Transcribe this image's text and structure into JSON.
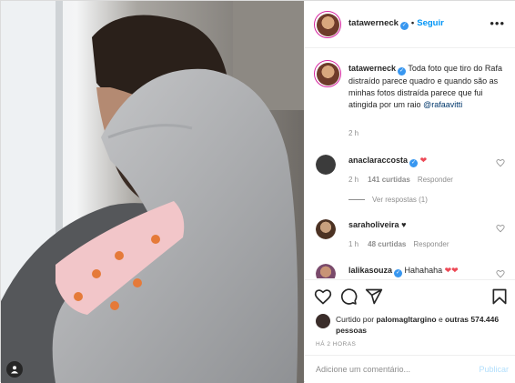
{
  "post": {
    "author": "tatawerneck",
    "follow_label": "Seguir",
    "separator": "•",
    "more_icon": "•••",
    "caption": "Toda foto que tiro do Rafa distraído parece quadro e quando são as minhas fotos distraída parece que fui atingida por um raio",
    "caption_mention": "@rafaavitti",
    "caption_time": "2 h"
  },
  "comments": [
    {
      "user": "anaclaraccosta",
      "emoji": "❤",
      "time": "2 h",
      "likes": "141 curtidas",
      "reply_label": "Responder",
      "view_replies": "Ver respostas (1)"
    },
    {
      "user": "saraholiveira",
      "emoji": "♥",
      "time": "1 h",
      "likes": "48 curtidas",
      "reply_label": "Responder"
    },
    {
      "user": "lalikasouza",
      "text": "Hahahaha",
      "emoji": "❤❤"
    }
  ],
  "likes": {
    "prefix": "Curtido por",
    "user": "palomagltargino",
    "connector": "e",
    "others": "outras 574.446 pessoas"
  },
  "posted_ago": "HÁ 2 HORAS",
  "composer": {
    "placeholder": "Adicione um comentário...",
    "publish_label": "Publicar"
  },
  "colors": {
    "link_blue": "#0095f6",
    "verified_blue": "#3897f0",
    "heart_red": "#ed4956",
    "muted": "#8e8e8e"
  }
}
